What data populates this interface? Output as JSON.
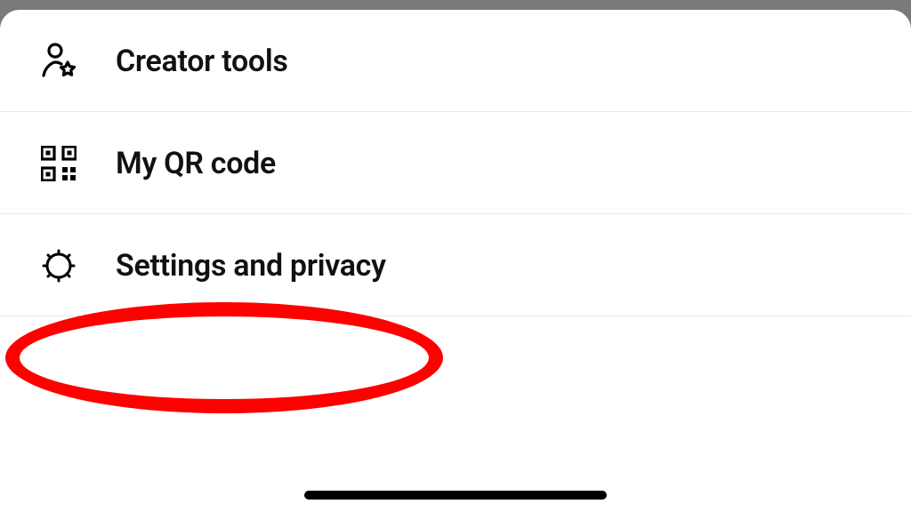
{
  "menu": {
    "items": [
      {
        "label": "Creator tools"
      },
      {
        "label": "My QR code"
      },
      {
        "label": "Settings and privacy"
      }
    ]
  }
}
